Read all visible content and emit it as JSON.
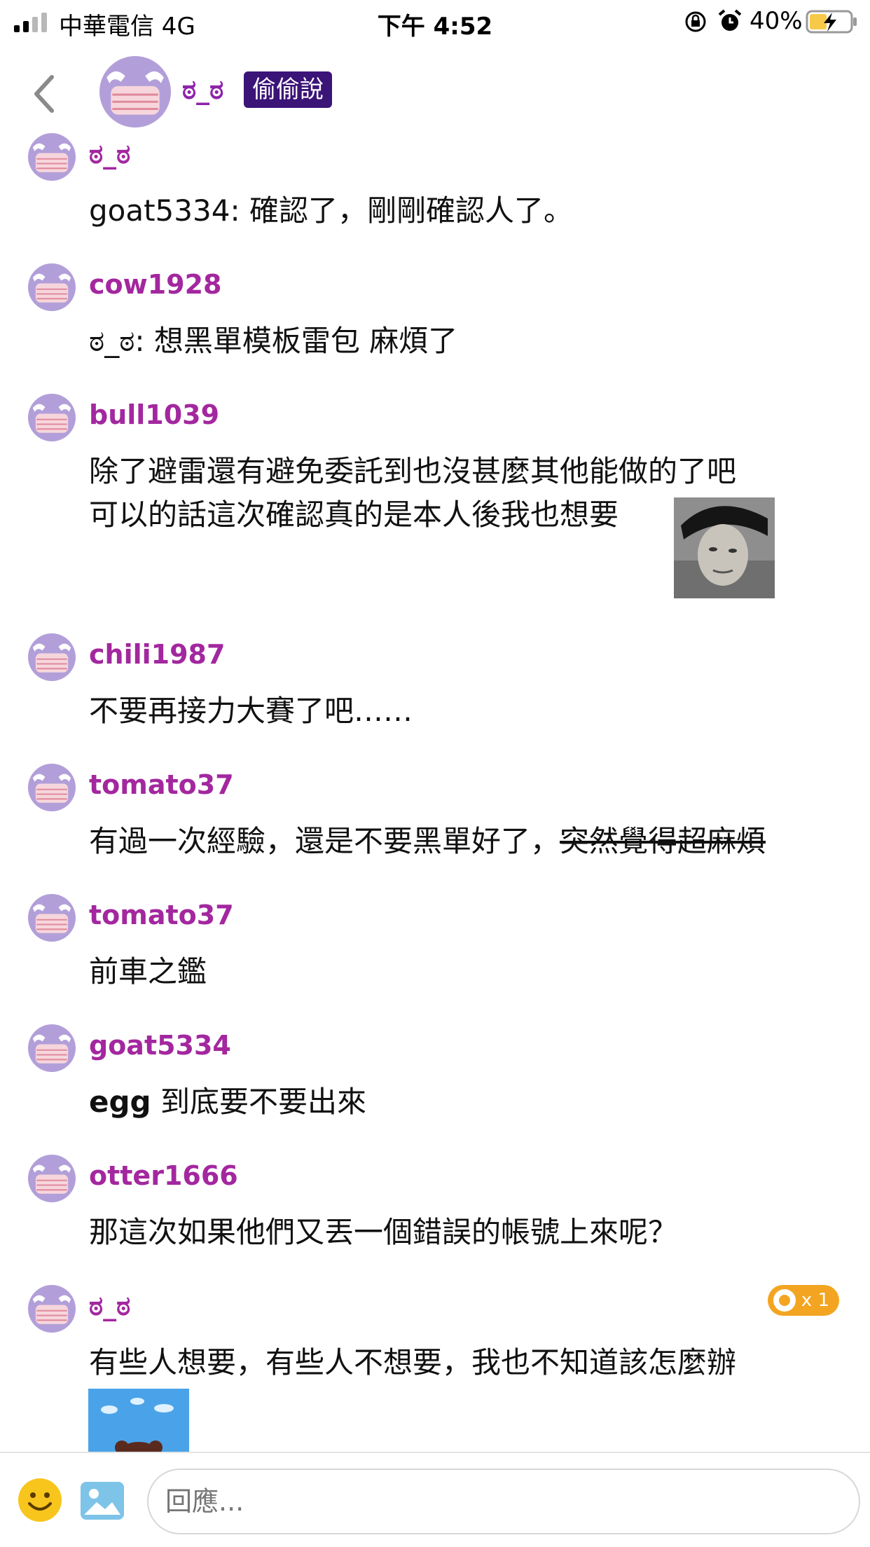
{
  "status_bar": {
    "carrier": "中華電信   4G",
    "time": "下午 4:52",
    "battery": "40%"
  },
  "header": {
    "name": "ಠ_ಠ",
    "badge": "偷偷說"
  },
  "comments": [
    {
      "user": "ಠ_ಠ",
      "text": "goat5334: 確認了，剛剛確認人了。"
    },
    {
      "user": "cow1928",
      "text": "ಠ_ಠ: 想黑單模板雷包 麻煩了"
    },
    {
      "user": "bull1039",
      "line1": "除了避雷還有避免委託到也沒甚麼其他能做的了吧",
      "line2": "可以的話這次確認真的是本人後我也想要"
    },
    {
      "user": "chili1987",
      "text": "不要再接力大賽了吧……"
    },
    {
      "user": "tomato37",
      "text_plain": "有過一次經驗，還是不要黑單好了，",
      "text_strike": "突然覺得超麻煩"
    },
    {
      "user": "tomato37",
      "text": "前車之鑑"
    },
    {
      "user": "goat5334",
      "text_bold": "egg",
      "text": " 到底要不要出來"
    },
    {
      "user": "otter1666",
      "text": "那這次如果他們又丟一個錯誤的帳號上來呢？"
    },
    {
      "user": "ಠ_ಠ",
      "text": "有些人想要，有些人不想要，我也不知道該怎麼辦",
      "reaction_count": "x 1"
    }
  ],
  "reply": {
    "placeholder": "回應..."
  },
  "colors": {
    "username": "#a3279f",
    "badge_bg": "#3b1478",
    "avatar": "#b09ad8",
    "reaction": "#f3a521"
  },
  "icons": [
    "back-icon",
    "emoji-icon",
    "image-icon",
    "lock-rotation-icon",
    "alarm-icon",
    "battery-icon"
  ]
}
